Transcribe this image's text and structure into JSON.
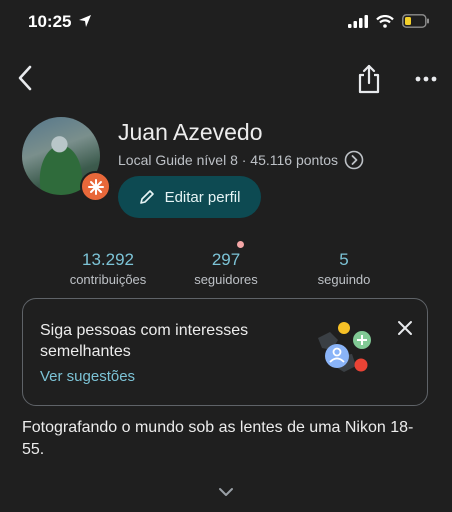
{
  "status_bar": {
    "time": "10:25"
  },
  "profile": {
    "name": "Juan Azevedo",
    "level_line": "Local Guide nível 8 · 45.116 pontos",
    "edit_label": "Editar perfil"
  },
  "stats": [
    {
      "value": "13.292",
      "label": "contribuições"
    },
    {
      "value": "297",
      "label": "seguidores"
    },
    {
      "value": "5",
      "label": "seguindo"
    }
  ],
  "suggestion_card": {
    "title": "Siga pessoas com interesses semelhantes",
    "link": "Ver sugestões"
  },
  "bio": "Fotografando o mundo sob as lentes de uma Nikon 18-55.",
  "colors": {
    "accent": "#7cc3d6",
    "button_bg": "#0d4a52",
    "badge": "#e8683a"
  },
  "icons": [
    "location-arrow-icon",
    "signal-icon",
    "wifi-icon",
    "battery-icon",
    "back-arrow-icon",
    "share-icon",
    "more-icon",
    "pencil-icon",
    "chevron-right-circle-icon",
    "close-icon",
    "chevron-down-icon"
  ]
}
